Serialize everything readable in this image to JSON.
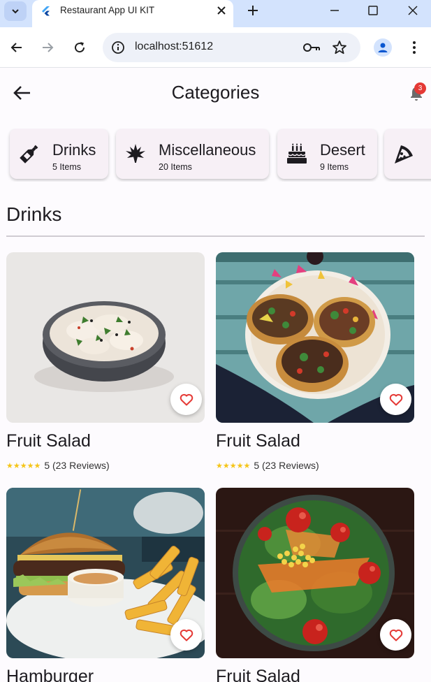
{
  "browser": {
    "tab_title": "Restaurant App UI KIT",
    "url": "localhost:51612"
  },
  "header": {
    "title": "Categories",
    "notification_count": "3"
  },
  "categories": [
    {
      "name": "Drinks",
      "count": "5 Items",
      "icon": "bottle-icon"
    },
    {
      "name": "Miscellaneous",
      "count": "20 Items",
      "icon": "leaf-icon"
    },
    {
      "name": "Desert",
      "count": "9 Items",
      "icon": "cake-icon"
    },
    {
      "name": "",
      "count": "",
      "icon": "pizza-icon"
    }
  ],
  "section": {
    "title": "Drinks"
  },
  "items": [
    {
      "name": "Fruit Salad",
      "rating": "5 (23 Reviews)",
      "image": "dumplings-bowl"
    },
    {
      "name": "Fruit Salad",
      "rating": "5 (23 Reviews)",
      "image": "tacos-plate"
    },
    {
      "name": "Hamburger",
      "rating": "",
      "image": "burger-fries"
    },
    {
      "name": "Fruit Salad",
      "rating": "",
      "image": "salad-bowl"
    }
  ],
  "colors": {
    "tabbar": "#d3e3fd",
    "card_bg": "#f7f0f6",
    "badge": "#e53935",
    "star": "#f5c518",
    "heart": "#e53935"
  }
}
